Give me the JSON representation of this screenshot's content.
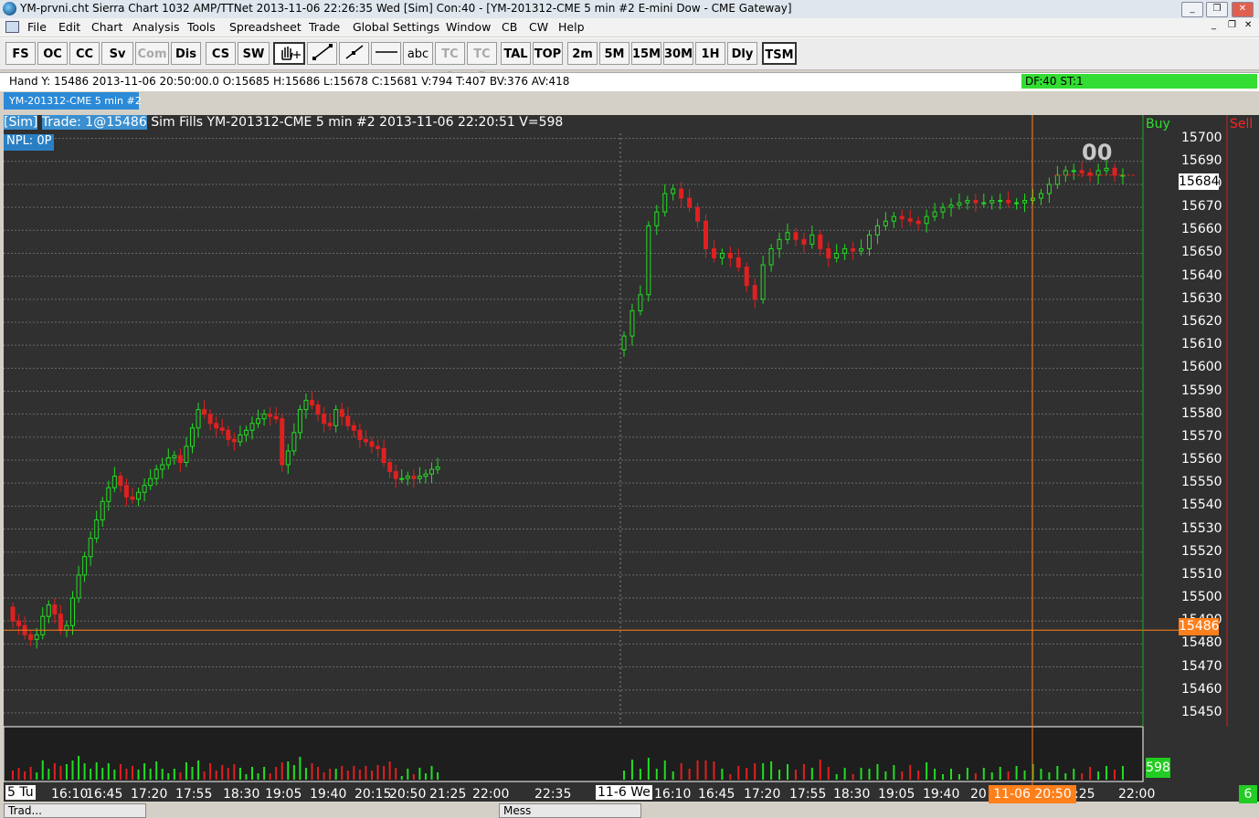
{
  "window": {
    "title": "YM-prvni.cht   Sierra Chart 1032 AMP/TTNet 2013-11-06   22:26:35 Wed [Sim]   Con:40 - [YM-201312-CME  5 min   #2  E-mini Dow - CME Gateway]",
    "controls": [
      "_",
      "❐",
      "✕"
    ],
    "inner_controls": [
      "_",
      "❐",
      "✕"
    ]
  },
  "menu": [
    "File",
    "Edit",
    "Chart",
    "Analysis",
    "Tools",
    "Spreadsheet",
    "Trade",
    "Global Settings",
    "Window",
    "CB",
    "CW",
    "Help"
  ],
  "toolbar": {
    "buttons": [
      "FS",
      "OC",
      "CC",
      "Sv",
      "Com",
      "Dis",
      "CS",
      "SW"
    ],
    "draw_tools": [
      "hand-tool-icon",
      "line-tool-icon",
      "ray-tool-icon",
      "horizontal-line-icon"
    ],
    "text_tools": [
      "abc",
      "TC 1",
      "TC 2"
    ],
    "periods": [
      "TAL",
      "TOP",
      "2m",
      "5M",
      "15M",
      "30M",
      "1H",
      "Dly",
      "TSM"
    ]
  },
  "infobar": {
    "text": "Hand Y: 15486   2013-11-06   20:50:00.0   O:15685   H:15686   L:15678   C:15681   V:794   T:407   BV:376   AV:418",
    "status": "DF:40   ST:1"
  },
  "tab": "YM-201312-CME  5 min   #2",
  "chart_header": {
    "sim": "[Sim]",
    "trade": "Trade: 1@15486",
    "rest": " Sim Fills  YM-201312-CME  5 min   #2 2013-11-06 22:20:51 V=598",
    "npl": "NPL: 0P",
    "counter": "00"
  },
  "side_labels": {
    "buy": "Buy",
    "sell": "Sell",
    "current_price": "15684",
    "last_trade_price": "15486",
    "volume": "598",
    "side_count": "6"
  },
  "colors": {
    "background": "#303030",
    "up": "#22dd22",
    "down": "#e02020",
    "cursor": "#ff7f1a"
  },
  "x_labels": {
    "start": "5 Tu",
    "day": "11-6 We",
    "cursor": "11-06  20:50",
    "ticks": [
      "16:10",
      "16:45",
      "17:20",
      "17:55",
      "18:30",
      "19:05",
      "19:40",
      "20:15",
      "20:50",
      "21:25",
      "22:00",
      "22:35",
      "16:10",
      "16:45",
      "17:20",
      "17:55",
      "18:30",
      "19:05",
      "19:40",
      "20",
      ":25",
      "22:00"
    ]
  },
  "taskbar": {
    "tabs": [
      "Trad...",
      "Mess"
    ]
  },
  "chart_data": {
    "type": "candlestick",
    "symbol": "YM-201312-CME",
    "interval": "5 min",
    "y_axis": {
      "ticks": [
        15700,
        15690,
        15680,
        15670,
        15660,
        15650,
        15640,
        15630,
        15620,
        15610,
        15600,
        15590,
        15580,
        15570,
        15560,
        15550,
        15540,
        15530,
        15520,
        15510,
        15500,
        15490,
        15480,
        15470,
        15460,
        15450
      ],
      "range": [
        15444,
        15707
      ]
    },
    "current_price": 15684,
    "horizontal_line": 15486,
    "session_1_closes": [
      15490,
      15488,
      15484,
      15482,
      15484,
      15492,
      15497,
      15493,
      15486,
      15488,
      15500,
      15510,
      15518,
      15526,
      15534,
      15542,
      15548,
      15553,
      15549,
      15544,
      15543,
      15546,
      15549,
      15552,
      15556,
      15558,
      15561,
      15562,
      15559,
      15566,
      15574,
      15582,
      15580,
      15576,
      15574,
      15573,
      15569,
      15568,
      15571,
      15573,
      15576,
      15578,
      15580,
      15579,
      15578,
      15558,
      15564,
      15572,
      15582,
      15586,
      15584,
      15580,
      15576,
      15575,
      15582,
      15579,
      15575,
      15573,
      15569,
      15568,
      15566,
      15565,
      15559,
      15555,
      15552,
      15552,
      15553,
      15552,
      15553,
      15554,
      15556,
      15557
    ],
    "session_2_closes": [
      15614,
      15625,
      15632,
      15662,
      15668,
      15676,
      15678,
      15674,
      15670,
      15664,
      15652,
      15648,
      15650,
      15648,
      15644,
      15636,
      15630,
      15645,
      15652,
      15656,
      15659,
      15656,
      15654,
      15658,
      15652,
      15648,
      15650,
      15652,
      15651,
      15652,
      15658,
      15662,
      15664,
      15666,
      15665,
      15664,
      15663,
      15666,
      15668,
      15670,
      15671,
      15672,
      15673,
      15672,
      15672,
      15673,
      15673,
      15672,
      15672,
      15673,
      15674,
      15676,
      15680,
      15684,
      15686,
      15686,
      15685,
      15684,
      15686,
      15687,
      15684,
      15684
    ]
  }
}
